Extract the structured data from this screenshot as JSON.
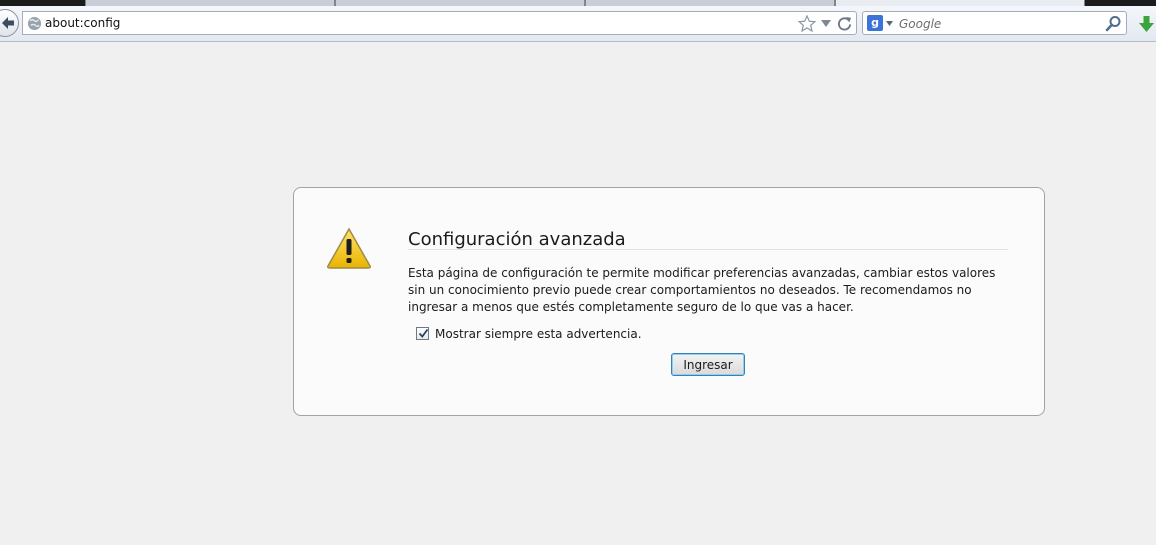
{
  "urlbar": {
    "url": "about:config"
  },
  "searchbar": {
    "placeholder": "Google",
    "engine_letter": "g"
  },
  "icons": {
    "back": "back-arrow-icon",
    "globe": "globe-icon",
    "star": "star-icon",
    "reload": "reload-icon",
    "magnifier": "search-icon",
    "download": "download-arrow-icon",
    "warning": "warning-triangle-icon"
  },
  "warning": {
    "title": "Configuración avanzada",
    "text": "Esta página de configuración te permite modificar preferencias avanzadas, cambiar estos valores sin un conocimiento previo puede crear comportamientos no deseados. Te recomendamos no ingresar a menos que estés completamente seguro de lo que vas a hacer.",
    "checkbox_label": "Mostrar siempre esta advertencia.",
    "checkbox_checked": true,
    "button_label": "Ingresar"
  },
  "colors": {
    "page_background": "#f0f0f0",
    "download_green": "#3aa53a",
    "warning_yellow": "#f4c81e"
  }
}
